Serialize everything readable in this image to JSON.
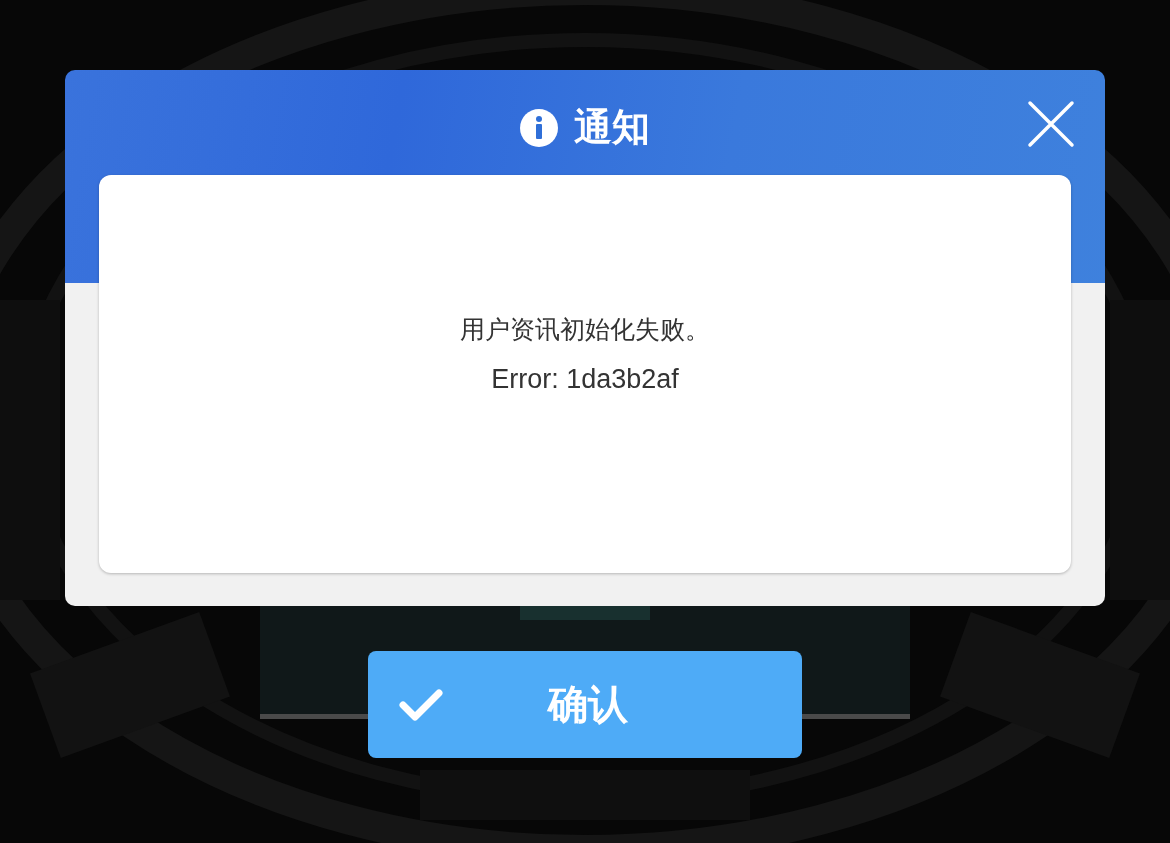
{
  "dialog": {
    "title": "通知",
    "message": "用户资讯初始化失败。",
    "error": "Error: 1da3b2af"
  },
  "confirm_button": {
    "label": "确认"
  }
}
